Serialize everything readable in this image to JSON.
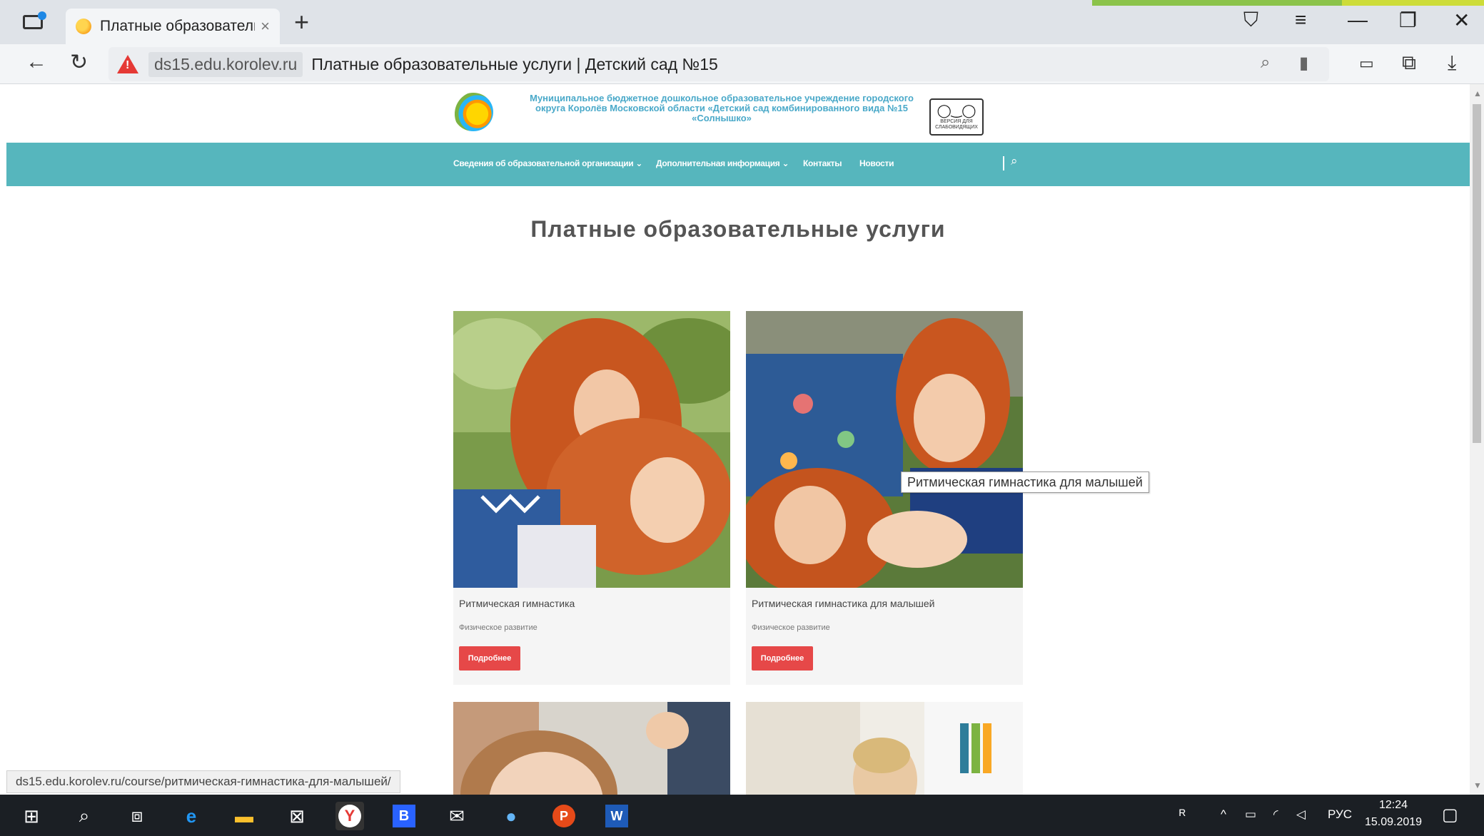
{
  "browser": {
    "tab_title": "Платные образовательн",
    "tab_close": "×",
    "new_tab": "+",
    "domain": "ds15.edu.korolev.ru",
    "page_title": "Платные образовательные услуги | Детский сад №15",
    "warning_glyph": "!"
  },
  "site": {
    "org_name": "Муниципальное бюджетное дошкольное образовательное учреждение городского округа Королёв Московской области «Детский сад комбинированного вида №15 «Солнышко»",
    "blind_version_label": "ВЕРСИЯ ДЛЯ СЛАБОВИДЯЩИХ",
    "menu": [
      {
        "label": "Сведения об образовательной организации ⌄"
      },
      {
        "label": "Дополнительная информация ⌄"
      },
      {
        "label": "Контакты"
      },
      {
        "label": "Новости"
      }
    ],
    "heading": "Платные образовательные услуги",
    "cards": [
      {
        "name": "Ритмическая гимнастика",
        "category": "Физическое развитие",
        "button": "Подробнее"
      },
      {
        "name": "Ритмическая гимнастика для малышей",
        "category": "Физическое развитие",
        "button": "Подробнее"
      }
    ],
    "tooltip": "Ритмическая гимнастика для малышей",
    "status_url": "ds15.edu.korolev.ru/course/ритмическая-гимнастика-для-малышей/"
  },
  "taskbar": {
    "language": "РУС",
    "time": "12:24",
    "date": "15.09.2019"
  },
  "colors": {
    "menu_bg": "#56b6bd",
    "button_red": "#e64848",
    "org_name": "#4aa9c9",
    "taskbar": "#1b1f24"
  }
}
